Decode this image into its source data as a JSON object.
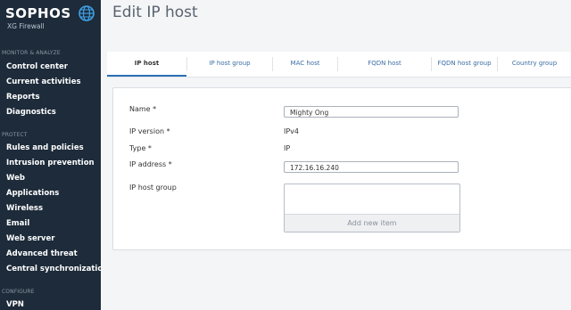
{
  "brand": {
    "name": "SOPHOS",
    "product": "XG Firewall"
  },
  "sidebar": {
    "sections": [
      {
        "title": "MONITOR & ANALYZE",
        "items": [
          "Control center",
          "Current activities",
          "Reports",
          "Diagnostics"
        ]
      },
      {
        "title": "PROTECT",
        "items": [
          "Rules and policies",
          "Intrusion prevention",
          "Web",
          "Applications",
          "Wireless",
          "Email",
          "Web server",
          "Advanced threat",
          "Central synchronization"
        ]
      },
      {
        "title": "CONFIGURE",
        "items": [
          "VPN"
        ]
      }
    ]
  },
  "page": {
    "title": "Edit IP host"
  },
  "tabs": [
    {
      "label": "IP host",
      "active": true
    },
    {
      "label": "IP host group",
      "active": false
    },
    {
      "label": "MAC host",
      "active": false
    },
    {
      "label": "FQDN host",
      "active": false
    },
    {
      "label": "FQDN host group",
      "active": false
    },
    {
      "label": "Country group",
      "active": false
    }
  ],
  "form": {
    "name_label": "Name *",
    "name_value": "Mighty Ong",
    "ip_version_label": "IP version *",
    "ip_version_value": "IPv4",
    "type_label": "Type *",
    "type_value": "IP",
    "ip_address_label": "IP address *",
    "ip_address_value": "172.16.16.240",
    "ip_host_group_label": "IP host group",
    "add_new_item": "Add new item"
  },
  "colors": {
    "sidebar_bg": "#1d2b3a",
    "accent": "#2b6fb5",
    "link": "#3c6ea6"
  },
  "icons": {
    "logo": "globe-icon"
  }
}
